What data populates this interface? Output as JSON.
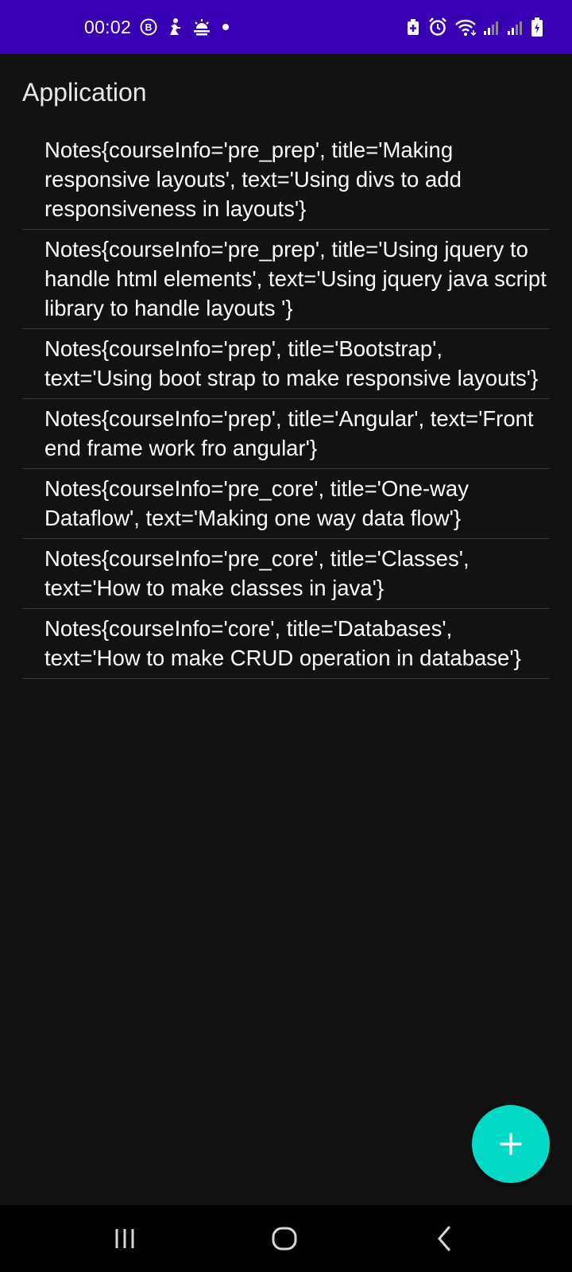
{
  "status_bar": {
    "time": "00:02",
    "left_icons": [
      "b-circle-icon",
      "figure-icon",
      "weather-icon",
      "dot-icon"
    ],
    "right_icons": [
      "battery-saver-icon",
      "alarm-icon",
      "wifi-icon",
      "signal-icon",
      "signal-icon",
      "battery-icon"
    ],
    "background": "#3700b3"
  },
  "app_bar": {
    "title": "Application"
  },
  "notes": [
    "Notes{courseInfo='pre_prep', title='Making responsive layouts', text='Using divs to add responsiveness in layouts'}",
    "Notes{courseInfo='pre_prep', title='Using jquery to handle html elements', text='Using jquery java script library to handle layouts '}",
    "Notes{courseInfo='prep', title='Bootstrap', text='Using boot strap to make responsive layouts'}",
    "Notes{courseInfo='prep', title='Angular', text='Front end frame work fro angular'}",
    "Notes{courseInfo='pre_core', title='One-way Dataflow', text='Making one way data flow'}",
    "Notes{courseInfo='pre_core', title='Classes', text='How to make classes in java'}",
    "Notes{courseInfo='core', title='Databases', text='How to make CRUD operation in database'}"
  ],
  "fab": {
    "icon": "plus-icon",
    "color": "#03dac5"
  },
  "nav_bar": {
    "buttons": [
      "recents-icon",
      "home-icon",
      "back-icon"
    ]
  }
}
